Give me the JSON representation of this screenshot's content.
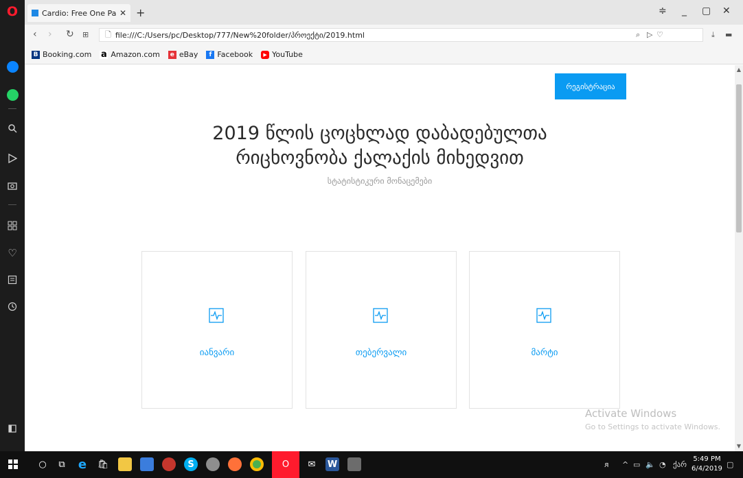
{
  "browser": {
    "tab_title": "Cardio: Free One Page Ten",
    "tab_close": "✕",
    "new_tab": "+",
    "url": "file:///C:/Users/pc/Desktop/777/New%20folder/პროექტი/2019.html"
  },
  "bookmarks": [
    {
      "label": "Booking.com",
      "icon": "booking-icon",
      "color": "#003580",
      "glyph": "B."
    },
    {
      "label": "Amazon.com",
      "icon": "amazon-icon",
      "color": "#000000",
      "glyph": "a"
    },
    {
      "label": "eBay",
      "icon": "ebay-icon",
      "color": "#f5af02",
      "glyph": "e"
    },
    {
      "label": "Facebook",
      "icon": "facebook-icon",
      "color": "#1877f2",
      "glyph": "f"
    },
    {
      "label": "YouTube",
      "icon": "youtube-icon",
      "color": "#ff0000",
      "glyph": "▶"
    }
  ],
  "page": {
    "register_button": "რეგისტრაცია",
    "title_line1": "2019 წლის ცოცხლად დაბადებულთა",
    "title_line2": "რიცხოვნობა ქალაქის მიხედვით",
    "subtitle": "სტატისტიკური მონაცემები",
    "cards": [
      {
        "label": "იანვარი",
        "icon": "heartbeat-icon"
      },
      {
        "label": "თებერვალი",
        "icon": "heartbeat-icon"
      },
      {
        "label": "მარტი",
        "icon": "heartbeat-icon"
      }
    ],
    "activate_title": "Activate Windows",
    "activate_sub": "Go to Settings to activate Windows."
  },
  "taskbar": {
    "time": "5:49 PM",
    "date": "6/4/2019",
    "language": "ქარ"
  },
  "colors": {
    "accent": "#0a9bf2",
    "opera_red": "#ff1b2d"
  }
}
